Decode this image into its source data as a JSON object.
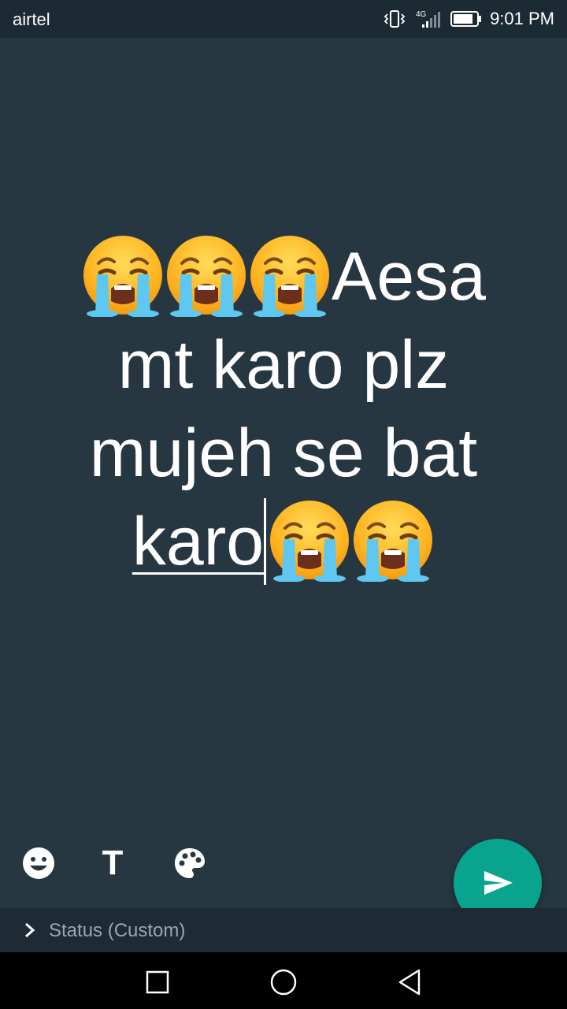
{
  "status_bar": {
    "carrier": "airtel",
    "network": "4G",
    "time": "9:01 PM"
  },
  "message": {
    "line1_text": "Aesa",
    "line2": "mt karo plz",
    "line3": "mujeh se bat",
    "line4_typed": "karo",
    "emoji": "loudly-crying-face"
  },
  "toolbar": {
    "emoji_icon": "smiley-icon",
    "text_tool_label": "T",
    "palette_icon": "palette-icon"
  },
  "send": {
    "icon": "send-icon",
    "color": "#09a48e"
  },
  "audience": {
    "label": "Status (Custom)"
  },
  "colors": {
    "background": "#263742",
    "accent": "#09a48e"
  }
}
